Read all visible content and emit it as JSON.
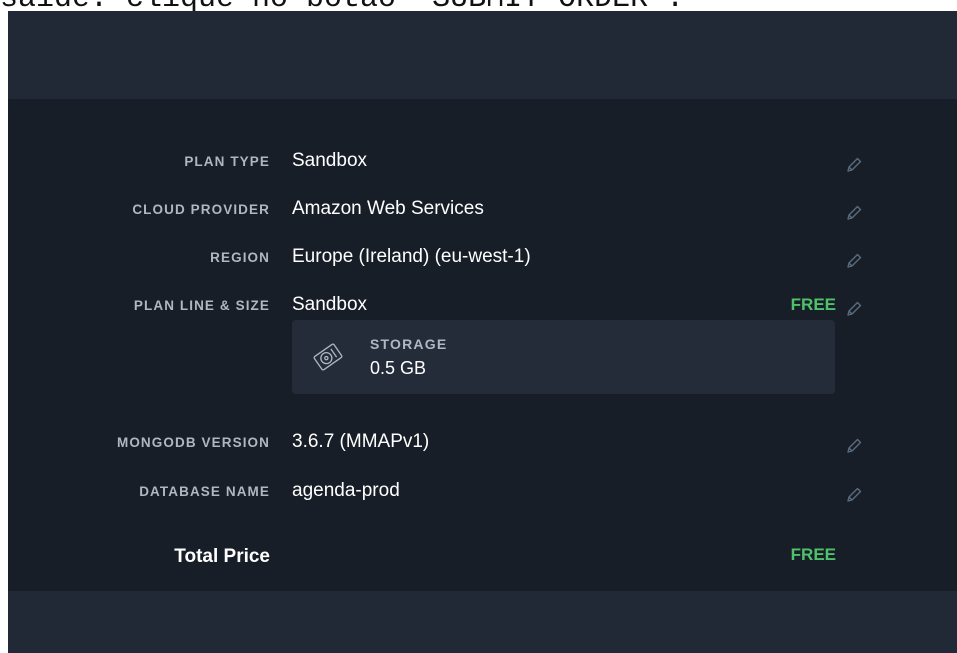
{
  "caption": "saide: clique no botão \"SUBMIT ORDER\".",
  "summary": {
    "rows": [
      {
        "label": "PLAN TYPE",
        "value": "Sandbox"
      },
      {
        "label": "CLOUD PROVIDER",
        "value": "Amazon Web Services"
      },
      {
        "label": "REGION",
        "value": "Europe (Ireland) (eu-west-1)"
      },
      {
        "label": "PLAN LINE & SIZE",
        "value": "Sandbox",
        "price": "FREE"
      },
      {
        "label": "MONGODB VERSION",
        "value": "3.6.7 (MMAPv1)"
      },
      {
        "label": "DATABASE NAME",
        "value": "agenda-prod"
      }
    ],
    "storage": {
      "label": "STORAGE",
      "value": "0.5 GB",
      "icon": "disk-icon"
    },
    "total": {
      "label": "Total Price",
      "value": "FREE"
    }
  },
  "colors": {
    "panel_background": "#1f2733",
    "summary_background": "#181e27",
    "label_text": "#aeb7c2",
    "value_text": "#ffffff",
    "free_green": "#4ec26a",
    "edit_icon": "#5b6b7d"
  },
  "icons": {
    "edit": "pencil-icon",
    "storage": "disk-icon"
  }
}
